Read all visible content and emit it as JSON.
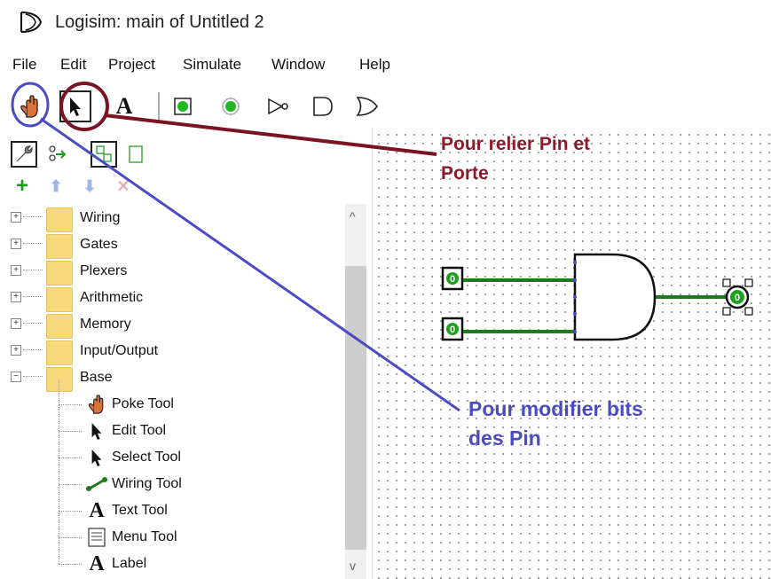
{
  "window": {
    "title": "Logisim: main of Untitled 2"
  },
  "menu": [
    "File",
    "Edit",
    "Project",
    "Simulate",
    "Window",
    "Help"
  ],
  "toolbar": {
    "tools": [
      "poke-tool",
      "edit-tool",
      "text-tool",
      "input-pin",
      "output-pin",
      "not-gate",
      "and-gate",
      "or-gate"
    ],
    "selected": "edit-tool"
  },
  "explorer": {
    "folders": [
      {
        "label": "Wiring",
        "expander": "+"
      },
      {
        "label": "Gates",
        "expander": "+"
      },
      {
        "label": "Plexers",
        "expander": "+"
      },
      {
        "label": "Arithmetic",
        "expander": "+"
      },
      {
        "label": "Memory",
        "expander": "+"
      },
      {
        "label": "Input/Output",
        "expander": "+"
      },
      {
        "label": "Base",
        "expander": "−"
      }
    ],
    "base_tools": [
      {
        "label": "Poke Tool",
        "icon": "hand-icon"
      },
      {
        "label": "Edit Tool",
        "icon": "arrow-icon"
      },
      {
        "label": "Select Tool",
        "icon": "arrow-icon"
      },
      {
        "label": "Wiring Tool",
        "icon": "wire-icon"
      },
      {
        "label": "Text Tool",
        "icon": "text-a-icon"
      },
      {
        "label": "Menu Tool",
        "icon": "menu-icon"
      },
      {
        "label": "Label",
        "icon": "text-a-icon"
      }
    ]
  },
  "circuit": {
    "input_pins": [
      "0",
      "0"
    ],
    "output_pin": "0",
    "gate": "AND",
    "wire_color": "#1f7a1f"
  },
  "annotations": {
    "red_line1": "Pour relier Pin et",
    "red_line2": "Porte",
    "blue_line1": "Pour modifier bits",
    "blue_line2": "des Pin",
    "red_color": "#8b1a2a",
    "blue_color": "#4b4bc4"
  }
}
